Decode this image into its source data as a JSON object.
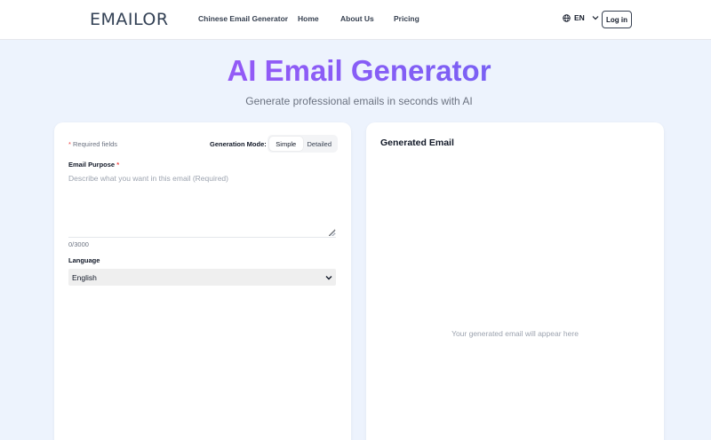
{
  "header": {
    "logo_text": "EMAILOR",
    "nav": [
      "Chinese Email Generator",
      "Home",
      "About Us",
      "Pricing"
    ],
    "language": "EN",
    "login_label": "Log in"
  },
  "hero": {
    "title": "AI Email Generator",
    "subtitle": "Generate professional emails in seconds with AI"
  },
  "form": {
    "required_star": "*",
    "required_note": "Required fields",
    "mode_label": "Generation Mode:",
    "modes": [
      "Simple",
      "Detailed"
    ],
    "selected_mode": "Simple",
    "purpose_label": "Email Purpose",
    "purpose_placeholder": "Describe what you want in this email (Required)",
    "purpose_value": "",
    "char_count": "0/3000",
    "language_label": "Language",
    "language_value": "English"
  },
  "output": {
    "title": "Generated Email",
    "placeholder": "Your generated email will appear here"
  },
  "colors": {
    "page_bg": "#edf3fd",
    "title_gradient_start": "#a855f7",
    "title_gradient_end": "#6366f1",
    "required_star": "#ef4444"
  }
}
